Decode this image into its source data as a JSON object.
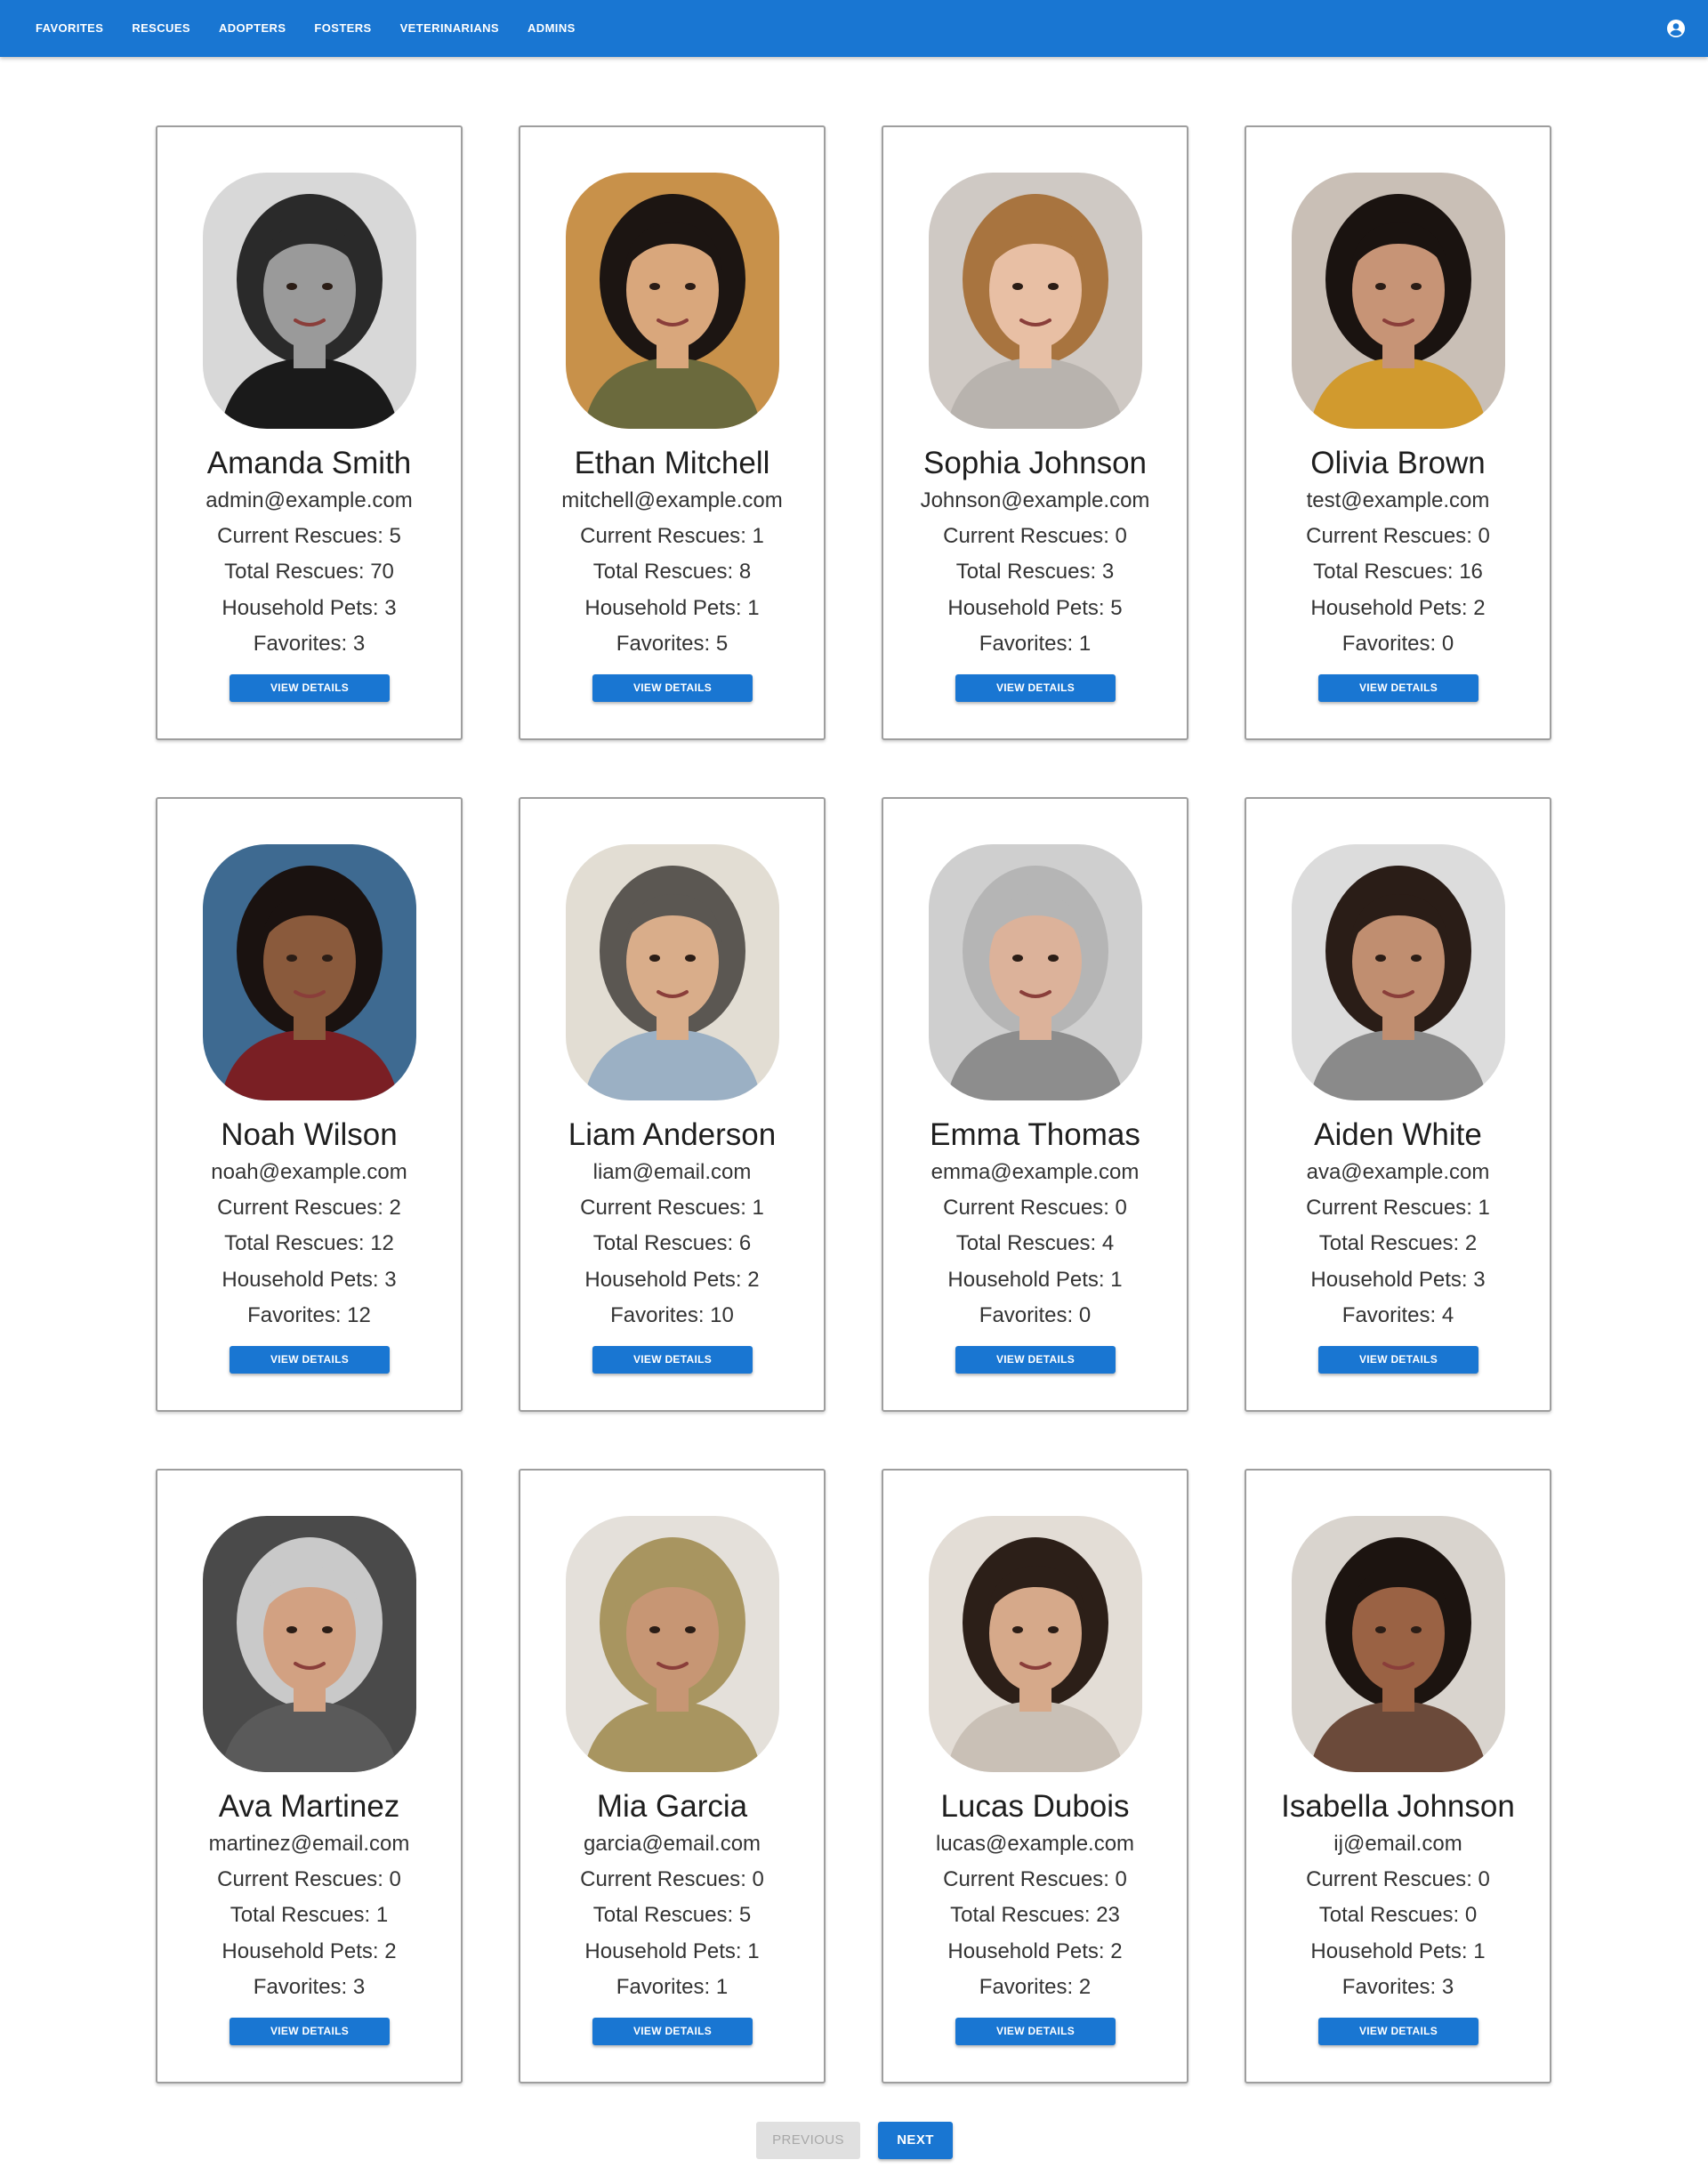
{
  "nav": {
    "links": [
      "FAVORITES",
      "RESCUES",
      "ADOPTERS",
      "FOSTERS",
      "VETERINARIANS",
      "ADMINS"
    ],
    "account_icon": "account-circle-icon"
  },
  "labels": {
    "current_rescues": "Current Rescues",
    "total_rescues": "Total Rescues",
    "household_pets": "Household Pets",
    "favorites": "Favorites",
    "view_details": "VIEW DETAILS"
  },
  "users": [
    {
      "name": "Amanda Smith",
      "email": "admin@example.com",
      "current_rescues": "5",
      "total_rescues": "70",
      "household_pets": "3",
      "favorites": "3",
      "photo": {
        "bg": "#d8d8d8",
        "skin": "#9a9a9a",
        "hair": "#2a2a2a",
        "shirt": "#1a1a1a"
      }
    },
    {
      "name": "Ethan Mitchell",
      "email": "mitchell@example.com",
      "current_rescues": "1",
      "total_rescues": "8",
      "household_pets": "1",
      "favorites": "5",
      "photo": {
        "bg": "#c8914a",
        "skin": "#d9a77c",
        "hair": "#1c1512",
        "shirt": "#6b6a3d"
      }
    },
    {
      "name": "Sophia Johnson",
      "email": "Johnson@example.com",
      "current_rescues": "0",
      "total_rescues": "3",
      "household_pets": "5",
      "favorites": "1",
      "photo": {
        "bg": "#cfc9c4",
        "skin": "#e8bfa4",
        "hair": "#a8743f",
        "shirt": "#b8b3ae"
      }
    },
    {
      "name": "Olivia Brown",
      "email": "test@example.com",
      "current_rescues": "0",
      "total_rescues": "16",
      "household_pets": "2",
      "favorites": "0",
      "photo": {
        "bg": "#c9bfb6",
        "skin": "#c79476",
        "hair": "#1a1310",
        "shirt": "#d19a2e"
      }
    },
    {
      "name": "Noah Wilson",
      "email": "noah@example.com",
      "current_rescues": "2",
      "total_rescues": "12",
      "household_pets": "3",
      "favorites": "12",
      "photo": {
        "bg": "#3e6a91",
        "skin": "#8a5a3c",
        "hair": "#1a1210",
        "shirt": "#7a1f24"
      }
    },
    {
      "name": "Liam Anderson",
      "email": "liam@email.com",
      "current_rescues": "1",
      "total_rescues": "6",
      "household_pets": "2",
      "favorites": "10",
      "photo": {
        "bg": "#e2ddd3",
        "skin": "#d9ad8a",
        "hair": "#5b5752",
        "shirt": "#9bb0c4"
      }
    },
    {
      "name": "Emma Thomas",
      "email": "emma@example.com",
      "current_rescues": "0",
      "total_rescues": "4",
      "household_pets": "1",
      "favorites": "0",
      "photo": {
        "bg": "#cfcfcf",
        "skin": "#dcb29a",
        "hair": "#b5b5b5",
        "shirt": "#8d8d8d"
      }
    },
    {
      "name": "Aiden White",
      "email": "ava@example.com",
      "current_rescues": "1",
      "total_rescues": "2",
      "household_pets": "3",
      "favorites": "4",
      "photo": {
        "bg": "#dcdcdc",
        "skin": "#c08e70",
        "hair": "#2a1d17",
        "shirt": "#8a8a8a"
      }
    },
    {
      "name": "Ava Martinez",
      "email": "martinez@email.com",
      "current_rescues": "0",
      "total_rescues": "1",
      "household_pets": "2",
      "favorites": "3",
      "photo": {
        "bg": "#4a4a4a",
        "skin": "#d2a182",
        "hair": "#c9c9c9",
        "shirt": "#5a5a5a"
      }
    },
    {
      "name": "Mia Garcia",
      "email": "garcia@email.com",
      "current_rescues": "0",
      "total_rescues": "5",
      "household_pets": "1",
      "favorites": "1",
      "photo": {
        "bg": "#e4e0da",
        "skin": "#c79674",
        "hair": "#a89560",
        "shirt": "#a89560"
      }
    },
    {
      "name": "Lucas Dubois",
      "email": "lucas@example.com",
      "current_rescues": "0",
      "total_rescues": "23",
      "household_pets": "2",
      "favorites": "2",
      "photo": {
        "bg": "#e3ddd6",
        "skin": "#d6a98a",
        "hair": "#2c1f18",
        "shirt": "#c9c0b6"
      }
    },
    {
      "name": "Isabella Johnson",
      "email": "ij@email.com",
      "current_rescues": "0",
      "total_rescues": "0",
      "household_pets": "1",
      "favorites": "3",
      "photo": {
        "bg": "#d9d4ce",
        "skin": "#9a6244",
        "hair": "#1c1410",
        "shirt": "#6b4a3a"
      }
    }
  ],
  "pagination": {
    "previous_label": "PREVIOUS",
    "next_label": "NEXT",
    "previous_disabled": true
  },
  "colors": {
    "primary": "#1976d2",
    "disabled_bg": "#e0e0e0",
    "disabled_text": "#a8a8a8"
  }
}
